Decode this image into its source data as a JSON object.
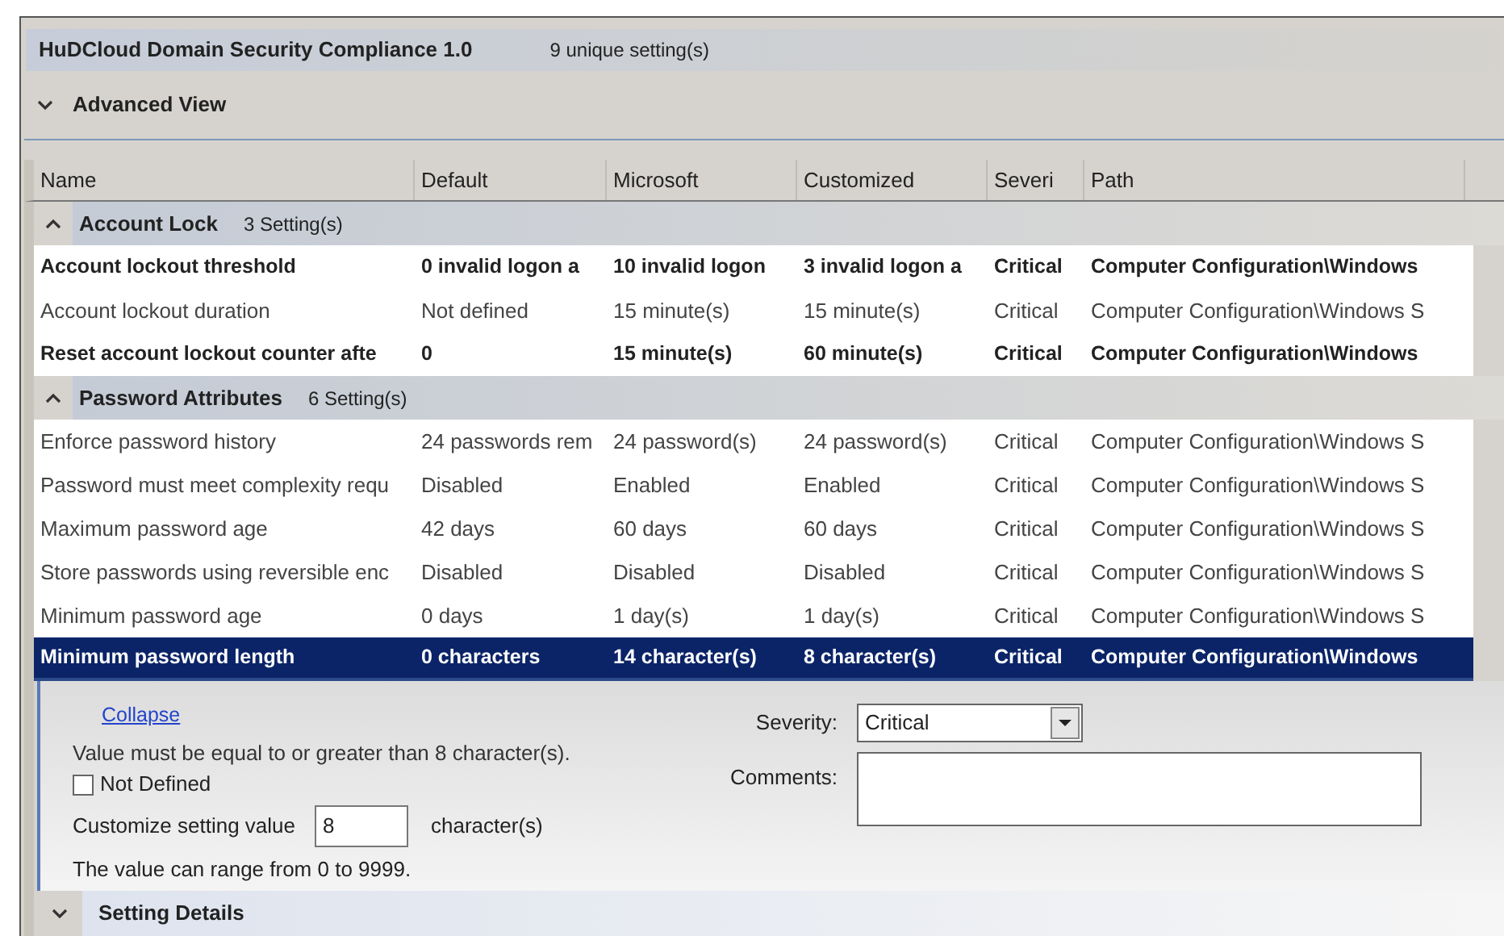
{
  "header": {
    "title": "HuDCloud Domain Security Compliance 1.0",
    "count": "9 unique setting(s)"
  },
  "advanced_view": {
    "label": "Advanced View",
    "expanded": true
  },
  "table": {
    "columns": [
      "Name",
      "Default",
      "Microsoft",
      "Customized",
      "Severi",
      "Path"
    ],
    "groups": [
      {
        "name": "Account Lock",
        "count": "3 Setting(s)",
        "expanded": true,
        "rows": [
          {
            "cells": [
              "Account lockout threshold",
              "0 invalid logon a",
              "10 invalid logon",
              "3 invalid logon a",
              "Critical",
              "Computer Configuration\\Windows"
            ],
            "emphasized": true,
            "selected": false
          },
          {
            "cells": [
              "Account lockout duration",
              "Not defined",
              "15 minute(s)",
              "15 minute(s)",
              "Critical",
              "Computer Configuration\\Windows S"
            ],
            "emphasized": false,
            "selected": false
          },
          {
            "cells": [
              "Reset account lockout counter afte",
              "0",
              "15 minute(s)",
              "60 minute(s)",
              "Critical",
              "Computer Configuration\\Windows"
            ],
            "emphasized": true,
            "selected": false
          }
        ]
      },
      {
        "name": "Password Attributes",
        "count": "6 Setting(s)",
        "expanded": true,
        "rows": [
          {
            "cells": [
              "Enforce password history",
              "24 passwords rem",
              "24 password(s)",
              "24 password(s)",
              "Critical",
              "Computer Configuration\\Windows S"
            ],
            "emphasized": false,
            "selected": false
          },
          {
            "cells": [
              "Password must meet complexity requ",
              "Disabled",
              "Enabled",
              "Enabled",
              "Critical",
              "Computer Configuration\\Windows S"
            ],
            "emphasized": false,
            "selected": false
          },
          {
            "cells": [
              "Maximum password age",
              "42 days",
              "60 days",
              "60 days",
              "Critical",
              "Computer Configuration\\Windows S"
            ],
            "emphasized": false,
            "selected": false
          },
          {
            "cells": [
              "Store passwords using reversible enc",
              "Disabled",
              "Disabled",
              "Disabled",
              "Critical",
              "Computer Configuration\\Windows S"
            ],
            "emphasized": false,
            "selected": false
          },
          {
            "cells": [
              "Minimum password age",
              "0 days",
              "1 day(s)",
              "1 day(s)",
              "Critical",
              "Computer Configuration\\Windows S"
            ],
            "emphasized": false,
            "selected": false
          },
          {
            "cells": [
              "Minimum password length",
              "0 characters",
              "14 character(s)",
              "8 character(s)",
              "Critical",
              "Computer Configuration\\Windows"
            ],
            "emphasized": true,
            "selected": true
          }
        ]
      }
    ]
  },
  "details": {
    "collapse_link": "Collapse",
    "rule": "Value must be equal to or greater than 8 character(s).",
    "not_defined": {
      "label": "Not Defined",
      "checked": false
    },
    "customize_label": "Customize setting value",
    "customize_value": "8",
    "unit": "character(s)",
    "range_note": "The value can range from 0 to 9999.",
    "severity_label": "Severity:",
    "severity_value": "Critical",
    "comments_label": "Comments:"
  },
  "setting_details": {
    "label": "Setting Details",
    "expanded": true
  }
}
